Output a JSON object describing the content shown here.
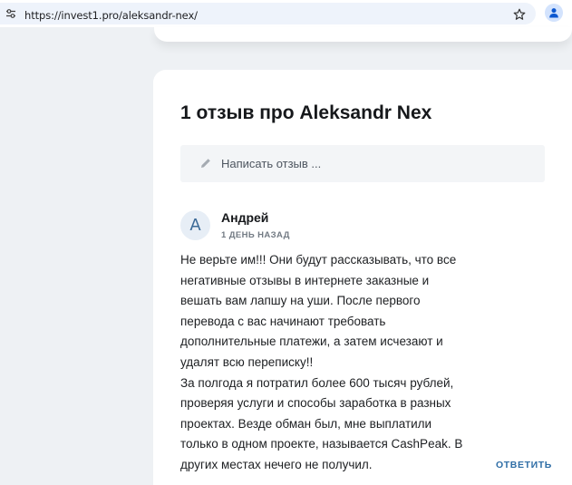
{
  "browser": {
    "url": "https://invest1.pro/aleksandr-nex/",
    "icons": {
      "site_info": "tune-icon",
      "bookmark": "star-icon",
      "profile": "profile-icon"
    }
  },
  "page": {
    "title": "1 отзыв про Aleksandr Nex",
    "write_review_placeholder": "Написать отзыв ..."
  },
  "review": {
    "avatar_letter": "А",
    "author": "Андрей",
    "date": "1 ДЕНЬ НАЗАД",
    "lines": [
      "Не верьте им!!! Они будут рассказывать, что все",
      "негативные отзывы в интернете заказные и",
      "вешать вам лапшу на уши. После первого",
      "перевода с вас начинают требовать",
      "дополнительные платежи, а затем исчезают и",
      "удалят всю переписку!!",
      "За полгода я потратил более 600 тысяч рублей,",
      "проверяя услуги и способы заработка в разных",
      "проектах. Везде обман был, мне выплатили",
      "только в одном проекте, называется CashPeak. В",
      "других местах нечего не получил."
    ],
    "reply_label": "ОТВЕТИТЬ"
  },
  "colors": {
    "page_background": "#eef1f4",
    "card_background": "#ffffff",
    "accent": "#2f6ea6",
    "input_background": "#f3f5f7"
  }
}
